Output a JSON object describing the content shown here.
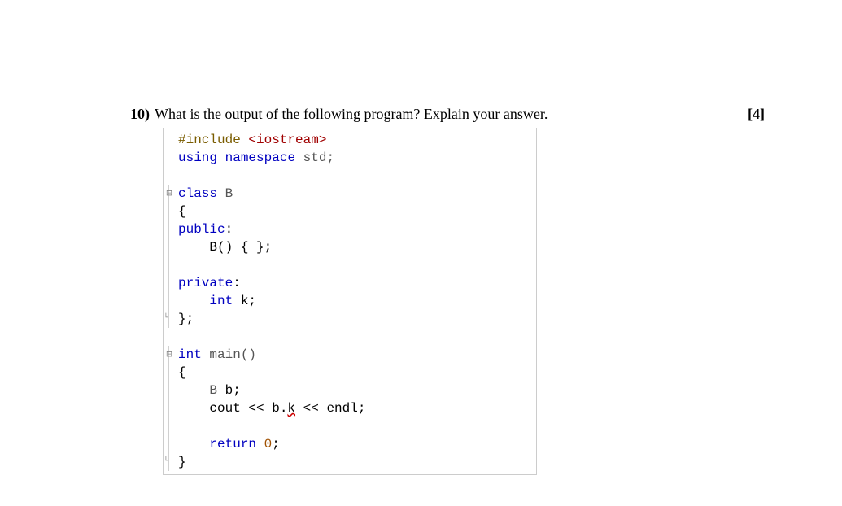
{
  "question": {
    "number": "10)",
    "text": "What is the output of the following program? Explain your answer.",
    "marks": "[4]"
  },
  "code": {
    "lines": {
      "include_pp": "#include",
      "include_lib": "<iostream>",
      "using": "using",
      "namespace_kw": "namespace",
      "std": "std;",
      "class_kw": "class",
      "class_name": "B",
      "open1": "{",
      "public": "public",
      "colon1": ":",
      "ctor": "    B() { };",
      "private": "private",
      "colon2": ":",
      "int_kw": "int",
      "k_decl": " k;",
      "close1": "};",
      "int_main_kw": "int",
      "main_name": " main()",
      "open2": "{",
      "b_decl_type": "B",
      "b_decl_var": " b;",
      "cout_pre": "    cout << b.",
      "k_err": "k",
      "cout_post": " << endl;",
      "return_kw": "return",
      "return_num": "0",
      "return_semi": ";",
      "close2": "}"
    }
  }
}
